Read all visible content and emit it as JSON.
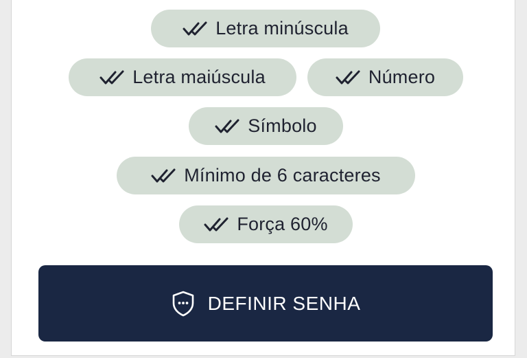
{
  "requirements": [
    {
      "label": "Letra minúscula",
      "met": true,
      "icon": "double-check-icon"
    },
    {
      "label": "Letra maiúscula",
      "met": true,
      "icon": "double-check-icon"
    },
    {
      "label": "Número",
      "met": true,
      "icon": "double-check-icon"
    },
    {
      "label": "Símbolo",
      "met": true,
      "icon": "double-check-icon"
    },
    {
      "label": "Mínimo de 6 caracteres",
      "met": true,
      "icon": "double-check-icon"
    },
    {
      "label": "Força 60%",
      "met": true,
      "icon": "double-check-icon"
    }
  ],
  "submit": {
    "label": "DEFINIR SENHA",
    "icon": "shield-icon"
  },
  "colors": {
    "chip_background": "#d3ddd4",
    "chip_text": "#1f2230",
    "button_background": "#1a2743",
    "button_text": "#ffffff"
  }
}
